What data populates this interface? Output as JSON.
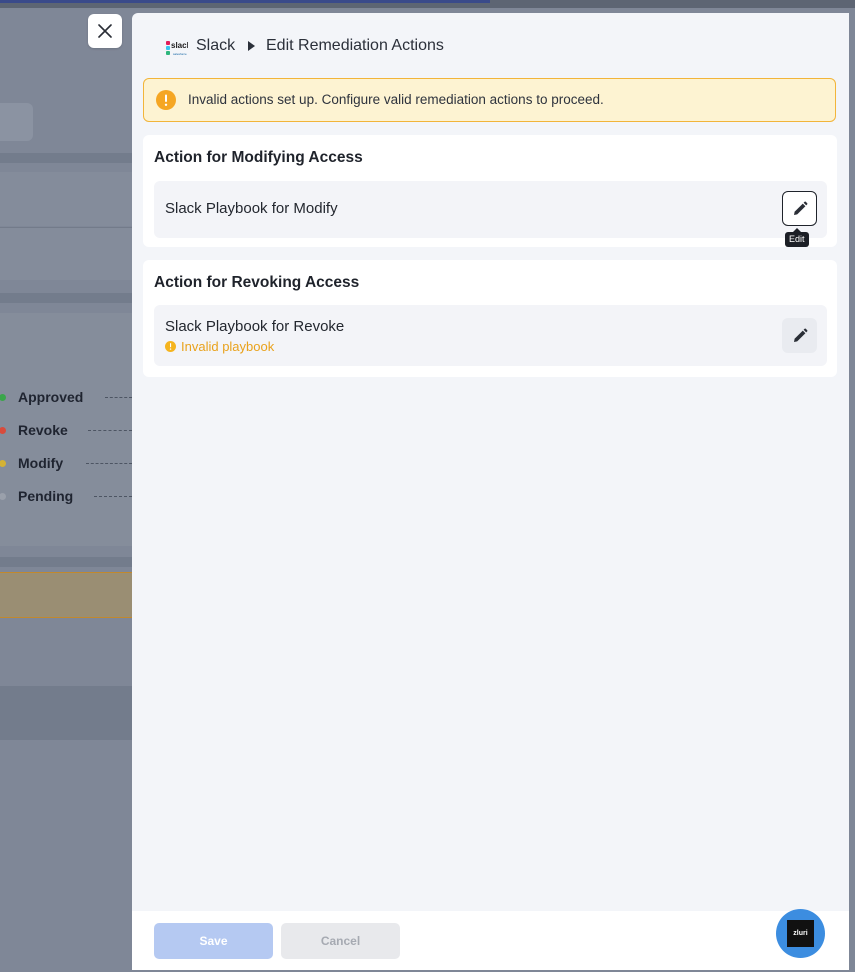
{
  "background": {
    "legend": [
      {
        "label": "Approved",
        "color": "#3aa64a"
      },
      {
        "label": "Revoke",
        "color": "#d84b3c"
      },
      {
        "label": "Modify",
        "color": "#d4b234"
      },
      {
        "label": "Pending",
        "color": "#9aa0ab"
      }
    ]
  },
  "header": {
    "app_name": "Slack",
    "page_title": "Edit Remediation Actions",
    "logo_icon": "slack-logo-icon"
  },
  "alert": {
    "message": "Invalid actions set up. Configure valid remediation actions to proceed.",
    "color": "#f2b53a"
  },
  "sections": [
    {
      "title": "Action for Modifying Access",
      "playbook": "Slack Playbook for Modify",
      "tooltip": "Edit"
    },
    {
      "title": "Action for Revoking Access",
      "playbook": "Slack Playbook for Revoke",
      "warning": "Invalid playbook"
    }
  ],
  "footer": {
    "save_label": "Save",
    "cancel_label": "Cancel"
  },
  "chat": {
    "label": "zluri"
  }
}
